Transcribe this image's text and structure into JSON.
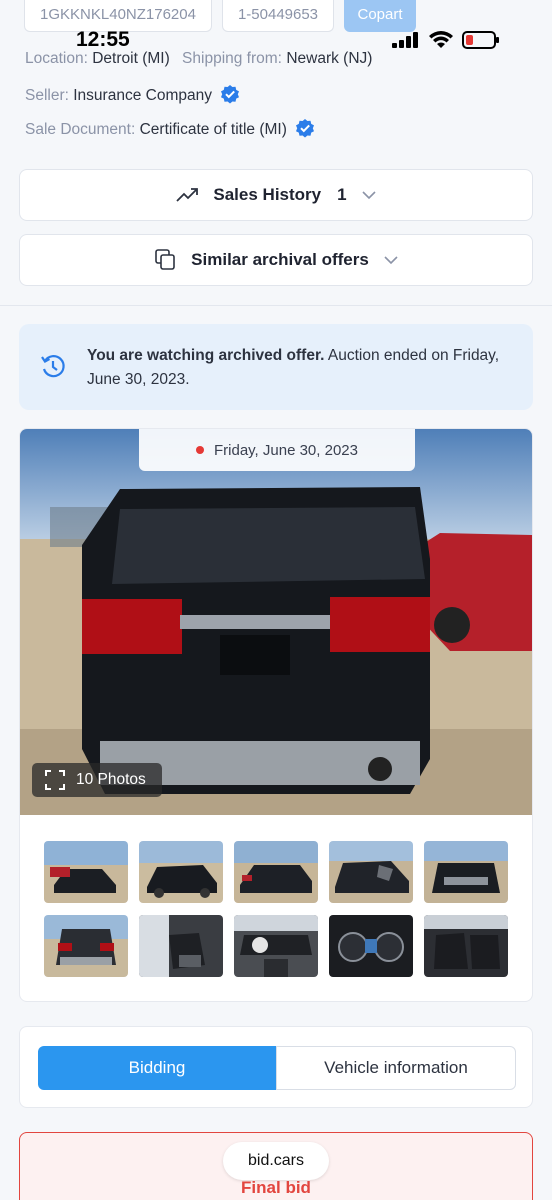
{
  "top_chips": {
    "vin": "1GKKNKL40NZ176204",
    "lot": "1-50449653",
    "auction": "Copart"
  },
  "status_bar": {
    "time": "12:55"
  },
  "location": {
    "label": "Location:",
    "value": "Detroit (MI)",
    "shipping_label": "Shipping from:",
    "shipping_value": "Newark (NJ)"
  },
  "seller": {
    "label": "Seller:",
    "value": "Insurance Company"
  },
  "sale_document": {
    "label": "Sale Document:",
    "value": "Certificate of title (MI)"
  },
  "sales_history": {
    "label": "Sales History",
    "count": "1"
  },
  "similar_offers": {
    "label": "Similar archival offers"
  },
  "notice": {
    "bold": "You are watching archived offer.",
    "text": " Auction ended on Friday, June 30, 2023."
  },
  "photo": {
    "date": "Friday, June 30, 2023",
    "photos_count": "10 Photos"
  },
  "tabs": {
    "bidding": "Bidding",
    "vehicle_info": "Vehicle information"
  },
  "bid": {
    "brand": "bid.cars",
    "final_bid": "Final bid"
  },
  "colors": {
    "accent": "#2b96ef",
    "red": "#e2463f",
    "verified": "#2b7de9"
  }
}
